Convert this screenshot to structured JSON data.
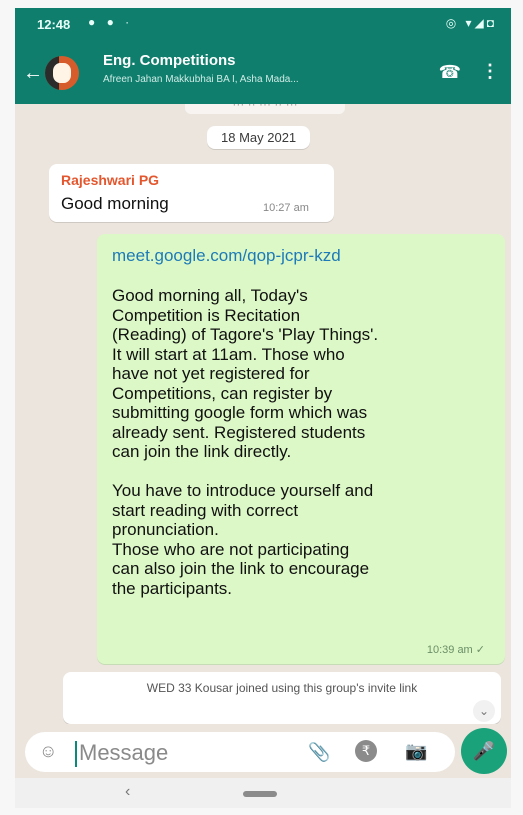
{
  "status": {
    "time": "12:48",
    "left_icons": "● ● ·",
    "right_icons": "◎ ▾◢◘"
  },
  "header": {
    "back_icon": "←",
    "title": "Eng. Competitions",
    "subtitle": "Afreen Jahan Makkubhai BA I, Asha Mada...",
    "call_icon": "☎",
    "menu_icon": "⋮"
  },
  "chat": {
    "cutoff_text": "··· ·· ··· ·· ···",
    "date": "18 May 2021",
    "messages": [
      {
        "sender": "Rajeshwari PG",
        "text": "Good morning",
        "time": "10:27 am"
      }
    ],
    "outgoing": {
      "link": "meet.google.com/qop-jcpr-kzd",
      "body": "Good morning all, Today's\nCompetition is  Recitation\n(Reading) of Tagore's 'Play Things'.\nIt will start at 11am. Those who\nhave not yet registered for\nCompetitions, can register by\nsubmitting google form which was\nalready sent. Registered  students\ncan join the link directly.\n\nYou have to introduce yourself and\nstart reading with correct\npronunciation.\nThose who are not participating\ncan also join the link to encourage\nthe participants.",
      "time": "10:39 am ✓"
    },
    "system_message": "WED 33 Kousar joined using this group's invite link",
    "scroll_icon": "⌄"
  },
  "input": {
    "emoji_icon": "☺",
    "placeholder": "Message",
    "attach_icon": "📎",
    "payment_icon": "₹",
    "camera_icon": "📷",
    "mic_icon": "🎤"
  },
  "nav": {
    "back_icon": "‹"
  },
  "colors": {
    "header": "#0f7e6d",
    "outgoing_bubble": "#dcf8c6",
    "mic_button": "#1aa27a"
  }
}
